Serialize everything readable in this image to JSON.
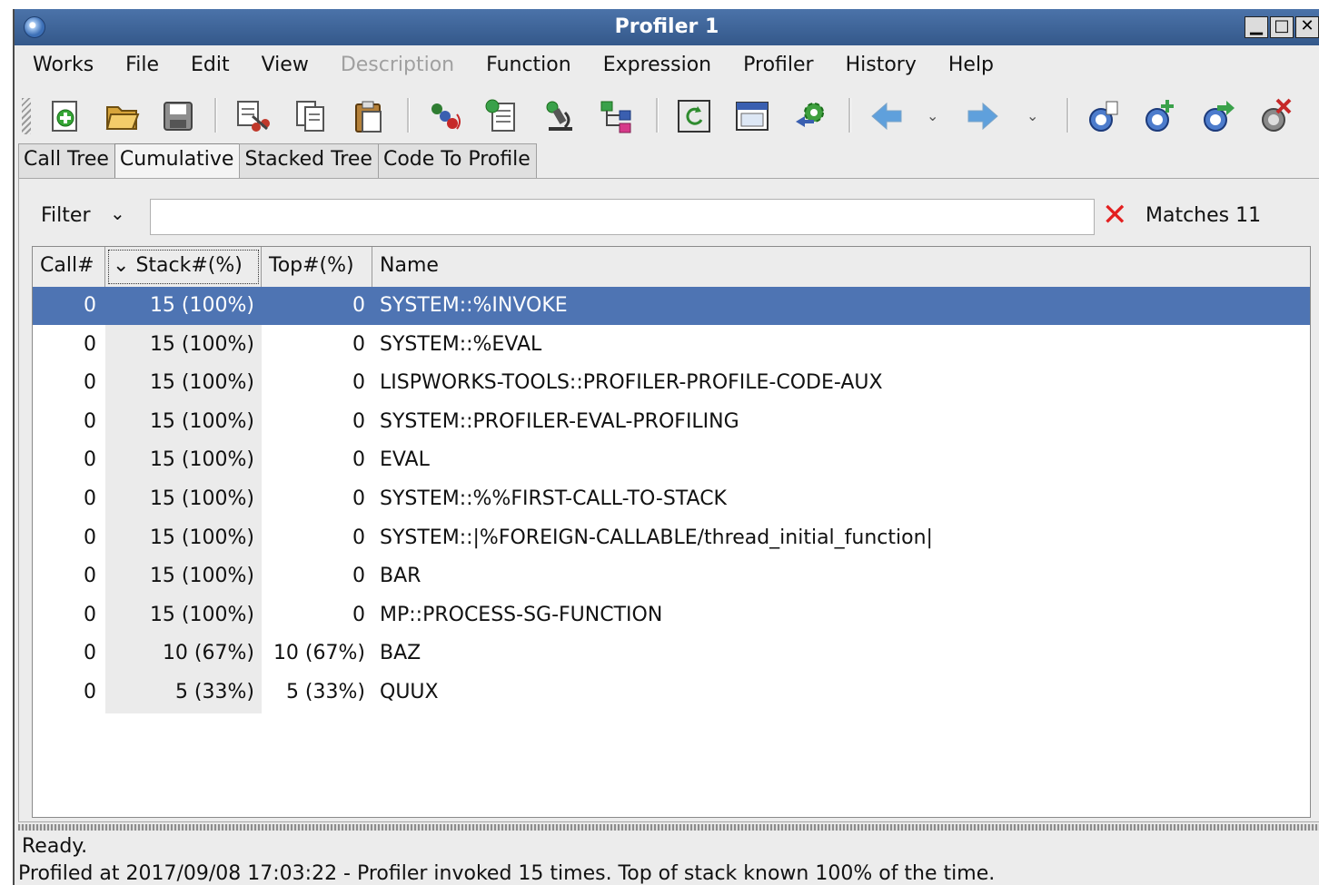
{
  "window": {
    "title": "Profiler 1"
  },
  "menu": [
    "Works",
    "File",
    "Edit",
    "View",
    "Description",
    "Function",
    "Expression",
    "Profiler",
    "History",
    "Help"
  ],
  "menu_disabled": [
    "Description"
  ],
  "toolbar_icons": [
    "new-icon",
    "open-folder-icon",
    "save-icon",
    "cut-icon",
    "copy-icon",
    "paste-icon",
    "inspect-icon",
    "describe-icon",
    "microscope-icon",
    "graph-icon",
    "refresh-icon",
    "window-icon",
    "gear-icon",
    "back-arrow-icon",
    "forward-arrow-icon",
    "profiler-settings-icon",
    "profiler-add-icon",
    "profiler-go-icon",
    "profiler-clear-icon"
  ],
  "tabs": [
    "Call Tree",
    "Cumulative",
    "Stacked Tree",
    "Code To Profile"
  ],
  "active_tab": "Cumulative",
  "filter": {
    "label": "Filter",
    "value": "",
    "matches": "Matches 11"
  },
  "table": {
    "columns": [
      "Call#",
      "Stack#(%)",
      "Top#(%)",
      "Name"
    ],
    "sorted_column": "Stack#(%)",
    "rows": [
      {
        "call": "0",
        "stack": "15 (100%)",
        "top": "0",
        "name": "SYSTEM::%INVOKE",
        "selected": true
      },
      {
        "call": "0",
        "stack": "15 (100%)",
        "top": "0",
        "name": "SYSTEM::%EVAL"
      },
      {
        "call": "0",
        "stack": "15 (100%)",
        "top": "0",
        "name": "LISPWORKS-TOOLS::PROFILER-PROFILE-CODE-AUX"
      },
      {
        "call": "0",
        "stack": "15 (100%)",
        "top": "0",
        "name": "SYSTEM::PROFILER-EVAL-PROFILING"
      },
      {
        "call": "0",
        "stack": "15 (100%)",
        "top": "0",
        "name": "EVAL"
      },
      {
        "call": "0",
        "stack": "15 (100%)",
        "top": "0",
        "name": "SYSTEM::%%FIRST-CALL-TO-STACK"
      },
      {
        "call": "0",
        "stack": "15 (100%)",
        "top": "0",
        "name": "SYSTEM::|%FOREIGN-CALLABLE/thread_initial_function|"
      },
      {
        "call": "0",
        "stack": "15 (100%)",
        "top": "0",
        "name": "BAR"
      },
      {
        "call": "0",
        "stack": "15 (100%)",
        "top": "0",
        "name": "MP::PROCESS-SG-FUNCTION"
      },
      {
        "call": "0",
        "stack": "10 (67%)",
        "top": "10 (67%)",
        "name": "BAZ"
      },
      {
        "call": "0",
        "stack": "5 (33%)",
        "top": "5 (33%)",
        "name": "QUUX"
      }
    ]
  },
  "status": {
    "line1": "Ready.",
    "line2": "Profiled at 2017/09/08 17:03:22 - Profiler invoked 15 times. Top of stack known 100% of the time."
  },
  "colors": {
    "selection": "#4e74b3",
    "titlebar": "#3f659b",
    "clear": "#e32020"
  }
}
